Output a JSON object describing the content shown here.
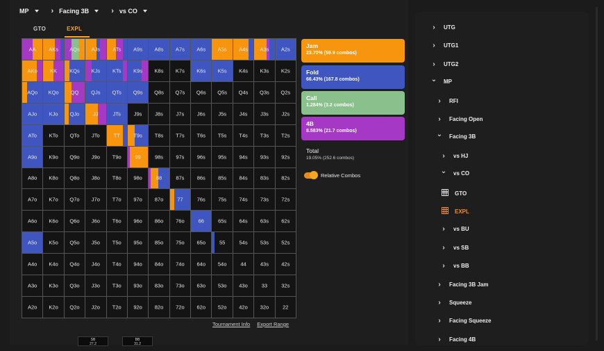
{
  "topbar": {
    "position": "MP",
    "scenario": "Facing 3B",
    "villain": "vs CO"
  },
  "tabs": [
    {
      "label": "GTO",
      "active": false
    },
    {
      "label": "EXPL",
      "active": true
    }
  ],
  "colors": {
    "jam": "#f7950f",
    "fold": "#3f55c0",
    "call": "#8ac08c",
    "fourbet": "#a638c6",
    "accent": "#f5a623"
  },
  "hands": [
    [
      "AA",
      "AKs",
      "AQs",
      "AJs",
      "ATs",
      "A9s",
      "A8s",
      "A7s",
      "A6s",
      "A5s",
      "A4s",
      "A3s",
      "A2s"
    ],
    [
      "AKo",
      "KK",
      "KQs",
      "KJs",
      "KTs",
      "K9s",
      "K8s",
      "K7s",
      "K6s",
      "K5s",
      "K4s",
      "K3s",
      "K2s"
    ],
    [
      "AQo",
      "KQo",
      "QQ",
      "QJs",
      "QTs",
      "Q9s",
      "Q8s",
      "Q7s",
      "Q6s",
      "Q5s",
      "Q4s",
      "Q3s",
      "Q2s"
    ],
    [
      "AJo",
      "KJo",
      "QJo",
      "JJ",
      "JTs",
      "J9s",
      "J8s",
      "J7s",
      "J6s",
      "J5s",
      "J4s",
      "J3s",
      "J2s"
    ],
    [
      "ATo",
      "KTo",
      "QTo",
      "JTo",
      "TT",
      "T9s",
      "T8s",
      "T7s",
      "T6s",
      "T5s",
      "T4s",
      "T3s",
      "T2s"
    ],
    [
      "A9o",
      "K9o",
      "Q9o",
      "J9o",
      "T9o",
      "99",
      "98s",
      "97s",
      "96s",
      "95s",
      "94s",
      "93s",
      "92s"
    ],
    [
      "A8o",
      "K8o",
      "Q8o",
      "J8o",
      "T8o",
      "98o",
      "88",
      "87s",
      "86s",
      "85s",
      "84s",
      "83s",
      "82s"
    ],
    [
      "A7o",
      "K7o",
      "Q7o",
      "J7o",
      "T7o",
      "97o",
      "87o",
      "77",
      "76s",
      "75s",
      "74s",
      "73s",
      "72s"
    ],
    [
      "A6o",
      "K6o",
      "Q6o",
      "J6o",
      "T6o",
      "96o",
      "86o",
      "76o",
      "66",
      "65s",
      "64s",
      "63s",
      "62s"
    ],
    [
      "A5o",
      "K5o",
      "Q5o",
      "J5o",
      "T5o",
      "95o",
      "85o",
      "75o",
      "65o",
      "55",
      "54s",
      "53s",
      "52s"
    ],
    [
      "A4o",
      "K4o",
      "Q4o",
      "J4o",
      "T4o",
      "94o",
      "84o",
      "74o",
      "64o",
      "54o",
      "44",
      "43s",
      "42s"
    ],
    [
      "A3o",
      "K3o",
      "Q3o",
      "J3o",
      "T3o",
      "93o",
      "83o",
      "73o",
      "63o",
      "53o",
      "43o",
      "33",
      "32s"
    ],
    [
      "A2o",
      "K2o",
      "Q2o",
      "J2o",
      "T2o",
      "92o",
      "82o",
      "72o",
      "62o",
      "52o",
      "42o",
      "32o",
      "22"
    ]
  ],
  "strategy": {
    "AA": [
      [
        "fourbet",
        0.5
      ],
      [
        "jam",
        0.5
      ]
    ],
    "AKs": [
      [
        "jam",
        0.55
      ],
      [
        "fourbet",
        0.3
      ],
      [
        "fold",
        0.15
      ]
    ],
    "AQs": [
      [
        "fourbet",
        0.35
      ],
      [
        "call",
        0.35
      ],
      [
        "jam",
        0.3
      ]
    ],
    "AJs": [
      [
        "jam",
        0.55
      ],
      [
        "fold",
        0.15
      ],
      [
        "fourbet",
        0.3
      ]
    ],
    "ATs": [
      [
        "jam",
        0.45
      ],
      [
        "fourbet",
        0.35
      ],
      [
        "fold",
        0.2
      ]
    ],
    "A9s": [
      [
        "fold",
        1
      ]
    ],
    "A8s": [
      [
        "fold",
        1
      ]
    ],
    "A7s": [
      [
        "fold",
        1
      ]
    ],
    "A6s": [
      [
        "fold",
        1
      ]
    ],
    "A5s": [
      [
        "jam",
        1
      ]
    ],
    "A4s": [
      [
        "jam",
        0.75
      ],
      [
        "fold",
        0.25
      ]
    ],
    "A3s": [
      [
        "jam",
        0.6
      ],
      [
        "fourbet",
        0.15
      ],
      [
        "fold",
        0.25
      ]
    ],
    "A2s": [
      [
        "fold",
        1
      ]
    ],
    "AKo": [
      [
        "jam",
        0.7
      ],
      [
        "fourbet",
        0.3
      ]
    ],
    "KK": [
      [
        "jam",
        0.5
      ],
      [
        "fourbet",
        0.5
      ]
    ],
    "KQs": [
      [
        "jam",
        0.25
      ],
      [
        "fold",
        0.75
      ]
    ],
    "KJs": [
      [
        "fourbet",
        0.3
      ],
      [
        "fold",
        0.7
      ]
    ],
    "KTs": [
      [
        "fold",
        0.8
      ],
      [
        "fourbet",
        0.2
      ]
    ],
    "K9s": [
      [
        "fold",
        0.7
      ],
      [
        "fourbet",
        0.3
      ]
    ],
    "K6s": [
      [
        "fold",
        1
      ]
    ],
    "K5s": [
      [
        "fold",
        1
      ]
    ],
    "AQo": [
      [
        "jam",
        0.25
      ],
      [
        "fold",
        0.75
      ]
    ],
    "KQo": [
      [
        "fold",
        1
      ]
    ],
    "QQ": [
      [
        "jam",
        0.35
      ],
      [
        "fourbet",
        0.65
      ]
    ],
    "QJs": [
      [
        "fold",
        1
      ]
    ],
    "QTs": [
      [
        "fold",
        1
      ]
    ],
    "Q9s": [
      [
        "fold",
        1
      ]
    ],
    "AJo": [
      [
        "fold",
        1
      ]
    ],
    "KJo": [
      [
        "fold",
        1
      ]
    ],
    "QJo": [
      [
        "jam",
        0.2
      ],
      [
        "fold",
        0.8
      ]
    ],
    "JJ": [
      [
        "jam",
        0.6
      ],
      [
        "fourbet",
        0.4
      ]
    ],
    "JTs": [
      [
        "fold",
        1
      ]
    ],
    "ATo": [
      [
        "fold",
        1
      ]
    ],
    "TT": [
      [
        "jam",
        0.8
      ],
      [
        "fold",
        0.2
      ]
    ],
    "T9s": [
      [
        "jam",
        0.35
      ],
      [
        "fold",
        0.65
      ]
    ],
    "A9o": [
      [
        "fold",
        1
      ]
    ],
    "99": [
      [
        "fourbet",
        0.12
      ],
      [
        "jam",
        0.88
      ]
    ],
    "88": [
      [
        "fourbet",
        0.1
      ],
      [
        "jam",
        0.35
      ],
      [
        "fold",
        0.55
      ]
    ],
    "77": [
      [
        "jam",
        0.2
      ],
      [
        "fold",
        0.8
      ]
    ],
    "66": [
      [
        "fold",
        1
      ]
    ],
    "A5o": [
      [
        "fold",
        1
      ]
    ],
    "55": [
      [
        "fold",
        0.12
      ]
    ]
  },
  "actions": [
    {
      "id": "jam",
      "name": "Jam",
      "detail": "23.70% (59.9 combos)"
    },
    {
      "id": "fold",
      "name": "Fold",
      "detail": "66.43% (167.8 combos)"
    },
    {
      "id": "call",
      "name": "Call",
      "detail": "1.284% (3.2 combos)"
    },
    {
      "id": "fourbet",
      "name": "4B",
      "detail": "8.583% (21.7 combos)"
    }
  ],
  "total": {
    "label": "Total",
    "detail": "19.05% (252.6 combos)"
  },
  "relative_combos": {
    "label": "Relative Combos",
    "on": true
  },
  "links": {
    "tournament_info": "Tournament Info",
    "export_range": "Export Range"
  },
  "stacks": [
    {
      "pos": "SB",
      "size": "27.2"
    },
    {
      "pos": "BB",
      "size": "31.2"
    }
  ],
  "nav": [
    {
      "label": "UTG",
      "icon": "chevron-right-icon",
      "level": 0
    },
    {
      "label": "UTG1",
      "icon": "chevron-right-icon",
      "level": 0
    },
    {
      "label": "UTG2",
      "icon": "chevron-right-icon",
      "level": 0
    },
    {
      "label": "MP",
      "icon": "chevron-down-icon",
      "level": 0
    },
    {
      "label": "RFI",
      "icon": "chevron-right-icon",
      "level": 1
    },
    {
      "label": "Facing Open",
      "icon": "chevron-right-icon",
      "level": 1
    },
    {
      "label": "Facing 3B",
      "icon": "chevron-down-icon",
      "level": 1
    },
    {
      "label": "vs HJ",
      "icon": "chevron-right-icon",
      "level": 2
    },
    {
      "label": "vs CO",
      "icon": "chevron-down-icon",
      "level": 2
    },
    {
      "label": "GTO",
      "icon": "grid-icon",
      "level": 3,
      "active": false
    },
    {
      "label": "EXPL",
      "icon": "grid-icon",
      "level": 3,
      "active": true
    },
    {
      "label": "vs BU",
      "icon": "chevron-right-icon",
      "level": 2
    },
    {
      "label": "vs SB",
      "icon": "chevron-right-icon",
      "level": 2
    },
    {
      "label": "vs BB",
      "icon": "chevron-right-icon",
      "level": 2
    },
    {
      "label": "Facing 3B Jam",
      "icon": "chevron-right-icon",
      "level": 1
    },
    {
      "label": "Squeeze",
      "icon": "chevron-right-icon",
      "level": 1
    },
    {
      "label": "Facing Squeeze",
      "icon": "chevron-right-icon",
      "level": 1
    },
    {
      "label": "Facing 4B",
      "icon": "chevron-right-icon",
      "level": 1
    }
  ]
}
